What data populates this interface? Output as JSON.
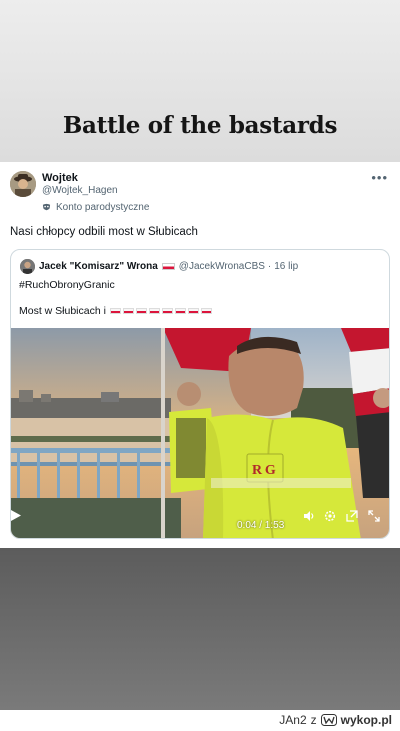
{
  "meme": {
    "title": "Battle of the bastards"
  },
  "tweet": {
    "author_name": "Wojtek",
    "author_handle": "@Wojtek_Hagen",
    "parody_label": "Konto parodystyczne",
    "text": "Nasi chłopcy odbili most w Słubicach",
    "more_icon": "more-horizontal-icon"
  },
  "quote": {
    "author_name": "Jacek \"Komisarz\" Wrona",
    "author_handle": "@JacekWronaCBS",
    "separator": "·",
    "date": "16 lip",
    "hashtag": "#RuchObronyGranic",
    "text": "Most w Słubicach i",
    "flag_count": 8
  },
  "video": {
    "timecode": "0:04 / 1:53",
    "vest_logo": "R G",
    "icons": [
      "play-icon",
      "volume-icon",
      "settings-icon",
      "popout-icon",
      "fullscreen-icon"
    ]
  },
  "footer": {
    "user": "JAn2",
    "via": "z",
    "site": "wykop.pl"
  },
  "colors": {
    "flag_red": "#dc143c",
    "vest_yellow": "#d6e83a",
    "link_gray": "#536471"
  }
}
